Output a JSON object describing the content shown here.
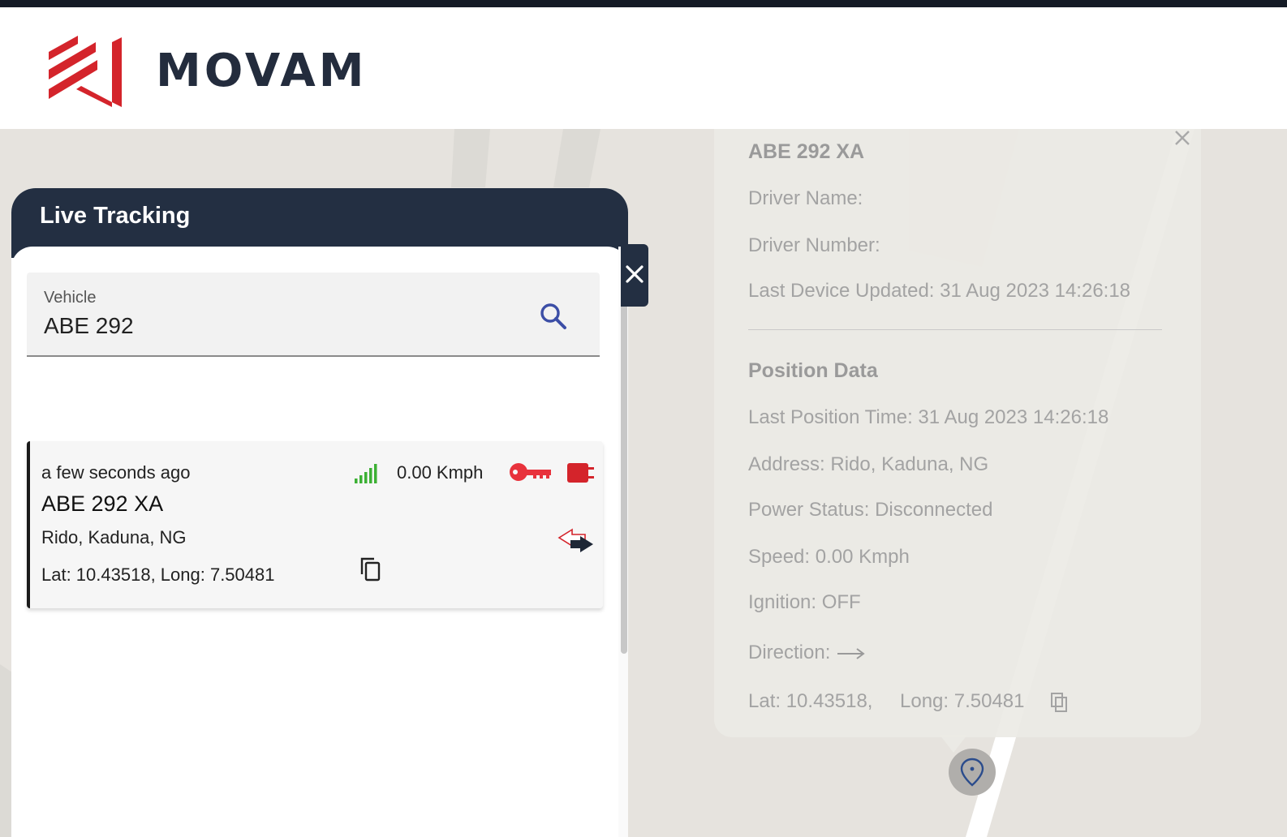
{
  "brand": {
    "name": "MOVAM",
    "accent": "#d4242b",
    "dark": "#232c3d"
  },
  "panel": {
    "title": "Live Tracking",
    "search": {
      "label": "Vehicle",
      "value": "ABE 292",
      "icon": "search-icon"
    },
    "close_icon": "close-icon"
  },
  "vehicle_card": {
    "time_ago": "a few seconds ago",
    "plate": "ABE 292 XA",
    "address": "Rido, Kaduna, NG",
    "coords": "Lat: 10.43518, Long: 7.50481",
    "speed": "0.00 Kmph",
    "icons": [
      "signal-strength-icon",
      "ignition-key-icon",
      "power-plug-icon",
      "direction-arrows-icon",
      "copy-icon"
    ],
    "status_colors": {
      "signal": "#3cb034",
      "ignition_off": "#e8323c",
      "power_off": "#d4242b"
    }
  },
  "popup": {
    "plate": "ABE 292 XA",
    "driver_name": "Driver Name:",
    "driver_number": "Driver Number:",
    "last_device_updated": "Last Device Updated: 31 Aug 2023 14:26:18",
    "position_heading": "Position Data",
    "last_position_time": "Last Position Time: 31 Aug 2023 14:26:18",
    "address": "Address: Rido, Kaduna, NG",
    "power_status": "Power Status: Disconnected",
    "speed": "Speed: 0.00 Kmph",
    "ignition": "Ignition: OFF",
    "direction": "Direction:",
    "lat": "Lat: 10.43518,",
    "long": "Long: 7.50481"
  },
  "map": {
    "marker_icon": "location-pin-icon"
  }
}
